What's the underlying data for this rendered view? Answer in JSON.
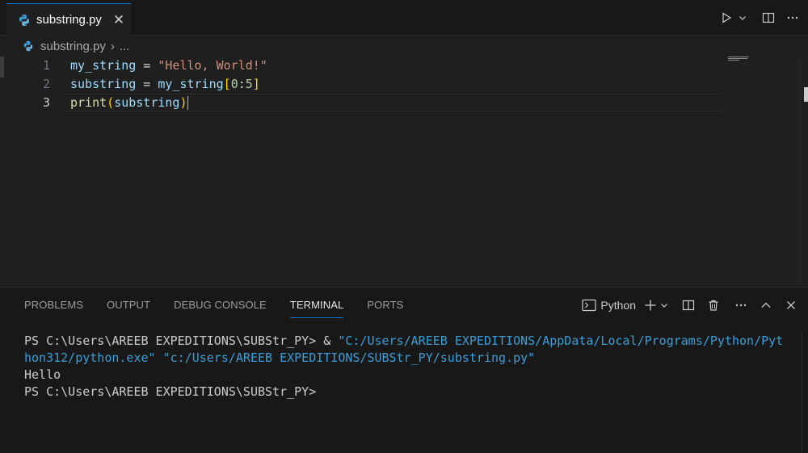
{
  "tab": {
    "title": "substring.py",
    "close_glyph": "✕"
  },
  "breadcrumb": {
    "file": "substring.py",
    "separator": "›",
    "ellipsis": "..."
  },
  "editor": {
    "line_numbers": [
      "1",
      "2",
      "3"
    ],
    "code": [
      [
        {
          "t": "my_string",
          "c": "var"
        },
        {
          "t": " = ",
          "c": "op"
        },
        {
          "t": "\"Hello, World!\"",
          "c": "str"
        }
      ],
      [
        {
          "t": "substring",
          "c": "var"
        },
        {
          "t": " = ",
          "c": "op"
        },
        {
          "t": "my_string",
          "c": "var"
        },
        {
          "t": "[",
          "c": "br"
        },
        {
          "t": "0",
          "c": "num"
        },
        {
          "t": ":",
          "c": "op"
        },
        {
          "t": "5",
          "c": "num"
        },
        {
          "t": "]",
          "c": "br"
        }
      ],
      [
        {
          "t": "print",
          "c": "fn"
        },
        {
          "t": "(",
          "c": "br"
        },
        {
          "t": "substring",
          "c": "var"
        },
        {
          "t": ")",
          "c": "br"
        }
      ]
    ]
  },
  "panel": {
    "tabs": [
      "PROBLEMS",
      "OUTPUT",
      "DEBUG CONSOLE",
      "TERMINAL",
      "PORTS"
    ],
    "active_tab": "TERMINAL",
    "terminal_label": "Python"
  },
  "terminal": {
    "prompt": "PS C:\\Users\\AREEB EXPEDITIONS\\SUBStr_PY> ",
    "amp": "& ",
    "path1_part1": "\"C:/Users/AREEB EXPEDITIONS/AppData/Local/Programs/Python/Pyt",
    "path1_part2": "hon312/python.exe\"",
    "path2": " \"c:/Users/AREEB EXPEDITIONS/SUBStr_PY/substring.py\"",
    "output": "Hello",
    "prompt2": "PS C:\\Users\\AREEB EXPEDITIONS\\SUBStr_PY>"
  },
  "colors": {
    "accent": "#0078d4",
    "string": "#ce9178",
    "variable": "#9cdcfe",
    "function": "#dcdcaa",
    "number": "#b5cea8",
    "bracket": "#ffd700",
    "terminal_path": "#3b9ed8"
  },
  "icons": [
    "python-file-icon",
    "run-icon",
    "split-editor-icon",
    "more-actions-icon",
    "terminal-icon",
    "add-terminal-icon",
    "chevron-down-icon",
    "trash-icon",
    "maximize-panel-icon",
    "close-panel-icon"
  ]
}
